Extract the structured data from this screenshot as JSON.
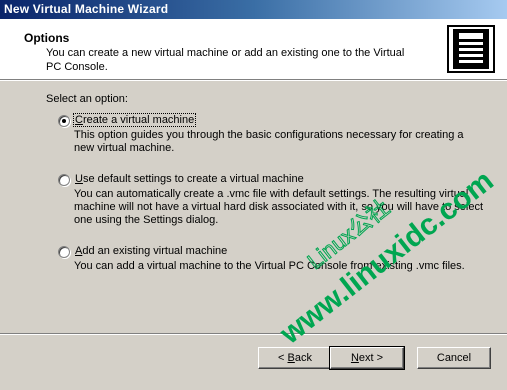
{
  "window": {
    "title": "New Virtual Machine Wizard"
  },
  "header": {
    "title": "Options",
    "description": "You can create a new virtual machine or add an existing one to the Virtual PC Console.",
    "icon": "server-icon"
  },
  "content": {
    "prompt": "Select an option:",
    "options": [
      {
        "label_pre": "",
        "label_ul": "C",
        "label_post": "reate a virtual machine",
        "description": "This option guides you through the basic configurations necessary for creating a new virtual machine.",
        "selected": true
      },
      {
        "label_pre": "",
        "label_ul": "U",
        "label_post": "se default settings to create a virtual machine",
        "description": "You can automatically create a .vmc file with default settings. The resulting virtual machine will not have a virtual hard disk associated with it, so you will have to select one using the Settings dialog.",
        "selected": false
      },
      {
        "label_pre": "",
        "label_ul": "A",
        "label_post": "dd an existing virtual machine",
        "description": "You can add a virtual machine to the Virtual PC Console from existing .vmc files.",
        "selected": false
      }
    ]
  },
  "buttons": {
    "back_pre": "< ",
    "back_ul": "B",
    "back_post": "ack",
    "next_ul": "N",
    "next_post": "ext >",
    "cancel": "Cancel"
  },
  "watermark": {
    "line1": "Linux公社",
    "line2": "www.linuxidc.com",
    "color": "#00a651"
  }
}
